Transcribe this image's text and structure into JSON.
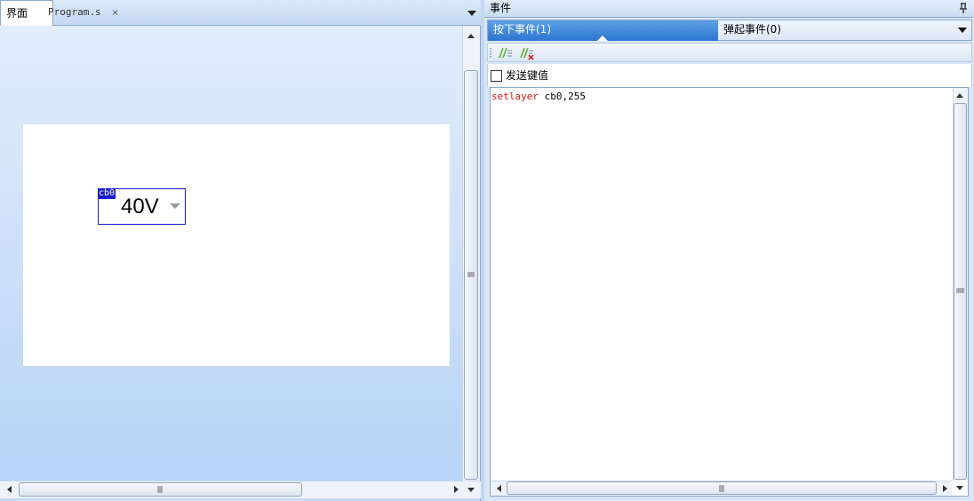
{
  "left_panel": {
    "tabs": [
      {
        "label": "界面",
        "active": true
      },
      {
        "label": "Program.s",
        "active": false
      }
    ],
    "tab_close_glyph": "×",
    "canvas": {
      "combo": {
        "tag": "cb0",
        "value": "40V"
      }
    }
  },
  "right_panel": {
    "title": "事件",
    "pin_glyph": "ᵖ",
    "event_tabs": [
      {
        "label": "按下事件(1)",
        "active": true
      },
      {
        "label": "弹起事件(0)",
        "active": false
      }
    ],
    "toolbar_icons": [
      "comment-icon",
      "uncomment-icon"
    ],
    "send_key_label": "发送键值",
    "send_key_checked": false,
    "code": {
      "keyword": "setlayer",
      "args": " cb0,255"
    }
  },
  "colors": {
    "keyword": "#e01515",
    "active_tab": "#2c76cf",
    "selection": "#1a1acc"
  }
}
